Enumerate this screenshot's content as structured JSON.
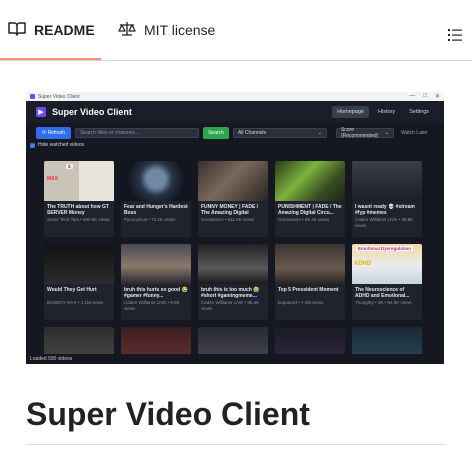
{
  "tabs": [
    {
      "label": "README",
      "icon": "book-icon",
      "active": true
    },
    {
      "label": "MIT license",
      "icon": "scale-icon",
      "active": false
    }
  ],
  "toc_icon": "list-icon",
  "screenshot": {
    "window_title": "Super Video Client",
    "window_controls": [
      "—",
      "□",
      "✕"
    ],
    "app_title": "Super Video Client",
    "nav": [
      "Homepage",
      "History",
      "Settings"
    ],
    "active_nav": "Homepage",
    "refresh_label": "⟳ Refresh",
    "search_placeholder": "Search titles or channels...",
    "search_label": "Search",
    "channels_select": "All Channels",
    "sort_select": "Score (Recommended)",
    "watch_later": "Watch Later",
    "hide_watched_label": "Hide watched videos",
    "videos": [
      {
        "title": "The TRUTH about how GT SERVER Money",
        "meta": "Some Tech Tips • 280.5K views",
        "thumb_text": "MAX",
        "badge": "$"
      },
      {
        "title": "Fear and Hunger's Hardest Boss",
        "meta": "Pyrocynical • 73.2K views",
        "thumb_text": "",
        "badge": ""
      },
      {
        "title": "FUNNY MONEY | FADE / The Amazing Digital Circu...",
        "meta": "Gooseworx • 511.6K views",
        "thumb_text": "",
        "badge": ""
      },
      {
        "title": "PUNISHMENT | FADE / The Amazing Digital Circu...",
        "meta": "Gooseworx • 69.3K views",
        "thumb_text": "",
        "badge": ""
      },
      {
        "title": "I wasnt ready 💀 #stream #fyp #memes",
        "meta": "Caden Williams LIVE • 36.9K views",
        "thumb_text": "",
        "badge": ""
      },
      {
        "title": "Would They Get Hurt",
        "meta": "BADBOY MAX • 1.1M views",
        "thumb_text": "",
        "badge": ""
      },
      {
        "title": "bruh this hurts so good 😭 #gamer #funny...",
        "meta": "Caden Williams LIVE • 6.8K views",
        "thumb_text": "",
        "badge": ""
      },
      {
        "title": "bruh this is too much 😭 #short #gamingmeme...",
        "meta": "Caden Williams LIVE • 85.4K views",
        "thumb_text": "",
        "badge": ""
      },
      {
        "title": "Top 5 Pressident Moment",
        "meta": "bsquared • 7.4M views",
        "thumb_text": "",
        "badge": ""
      },
      {
        "title": "The Neuroscience of ADHD and Emotional...",
        "meta": "Thoughty • 3K • 94.0K views",
        "thumb_text": "ADHD",
        "badge": "Emotional Dysregulation"
      },
      {
        "title": "",
        "meta": "",
        "thumb_text": "",
        "badge": ""
      },
      {
        "title": "",
        "meta": "",
        "thumb_text": "",
        "badge": ""
      },
      {
        "title": "",
        "meta": "",
        "thumb_text": "",
        "badge": ""
      },
      {
        "title": "",
        "meta": "",
        "thumb_text": "",
        "badge": ""
      },
      {
        "title": "",
        "meta": "",
        "thumb_text": "",
        "badge": ""
      }
    ],
    "status": "Loaded 590 videos"
  },
  "heading": "Super Video Client"
}
